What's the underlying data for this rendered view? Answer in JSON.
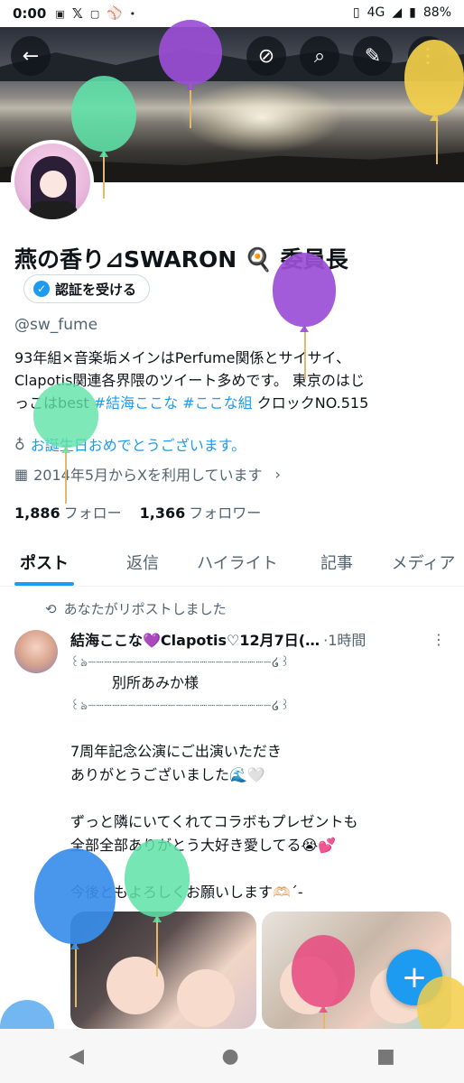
{
  "status_bar": {
    "time": "0:00",
    "left_icons": [
      "manga-up-icon",
      "x-icon",
      "showroom-icon",
      "baseball-icon",
      "dot-icon"
    ],
    "network": "4G",
    "battery": "88%"
  },
  "header_actions": {
    "back_icon": "←",
    "grok_icon": "⊘",
    "search_icon": "⌕",
    "edit_icon": "✎",
    "more_icon": "⋮"
  },
  "profile": {
    "display_name": "燕の香り⊿SWARON 🍳 委員長",
    "verify_button": "認証を受ける",
    "handle": "@sw_fume",
    "bio_line1": "93年組×音楽垢メインはPerfume関係とサイサイ、",
    "bio_line2": "Clapotis関連各界隈のツイート多めです。 東京のはじ",
    "bio_line3_prefix": "っこはbest ",
    "bio_tag1": "#結海ここな",
    "bio_tag2": "#ここな組",
    "bio_line3_suffix": " クロックNO.515",
    "birthday": "お誕生日おめでとうございます。",
    "joined": "2014年5月からXを利用しています",
    "following_count": "1,886",
    "following_label": "フォロー",
    "followers_count": "1,366",
    "followers_label": "フォロワー"
  },
  "tabs": [
    "ポスト",
    "返信",
    "ハイライト",
    "記事",
    "メディア"
  ],
  "post": {
    "repost_label": "あなたがリポストしました",
    "author": "結海ここな💜Clapotis♡12月7日(…",
    "time": "·1時間",
    "deco_top": "꒰ঌ┈┈┈┈┈┈┈┈┈┈┈┈┈┈┈┈┈┈┈┈┈┈┈໒꒱",
    "line_name": "別所あみか様",
    "deco_bottom": "꒰ঌ┈┈┈┈┈┈┈┈┈┈┈┈┈┈┈┈┈┈┈┈┈┈┈໒꒱",
    "line1": "7周年記念公演にご出演いただき",
    "line2": "ありがとうございました🌊🤍",
    "line3": "ずっと隣にいてくれてコラボもプレゼントも",
    "line4": "全部全部ありがとう大好き愛してる😭💕",
    "line5": "今後ともよろしくお願いします🫶🏻´-"
  },
  "fab_label": "+",
  "nav": {
    "back": "◀",
    "home": "●",
    "recents": "■"
  },
  "colors": {
    "accent": "#1d9bf0",
    "text": "#0f1419",
    "secondary": "#536471"
  }
}
